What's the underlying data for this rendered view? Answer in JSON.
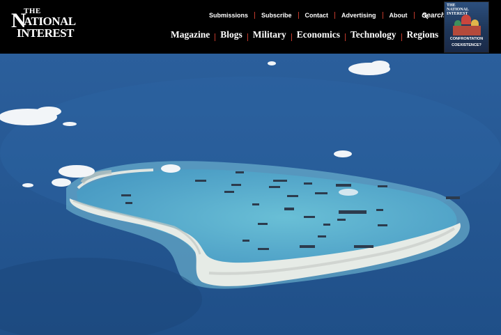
{
  "brand": {
    "logo_the": "THE",
    "logo_n": "N",
    "logo_national": "ATIONAL",
    "logo_interest": "INTEREST"
  },
  "top_nav": {
    "items": [
      "Submissions",
      "Subscribe",
      "Contact",
      "Advertising",
      "About"
    ],
    "search_label": "Search"
  },
  "main_nav": {
    "items": [
      "Magazine",
      "Blogs",
      "Military",
      "Economics",
      "Technology",
      "Regions"
    ]
  },
  "magazine_cover": {
    "brand": "THE NATIONAL INTEREST",
    "headline_1": "CONFRONTATION",
    "headline_2": "COEXISTENCE?"
  },
  "icons": {
    "search": "search-icon"
  },
  "colors": {
    "header_bg": "#000000",
    "separator": "#c0392b",
    "ocean": "#2d63a0",
    "lagoon": "#5ab2d0"
  }
}
